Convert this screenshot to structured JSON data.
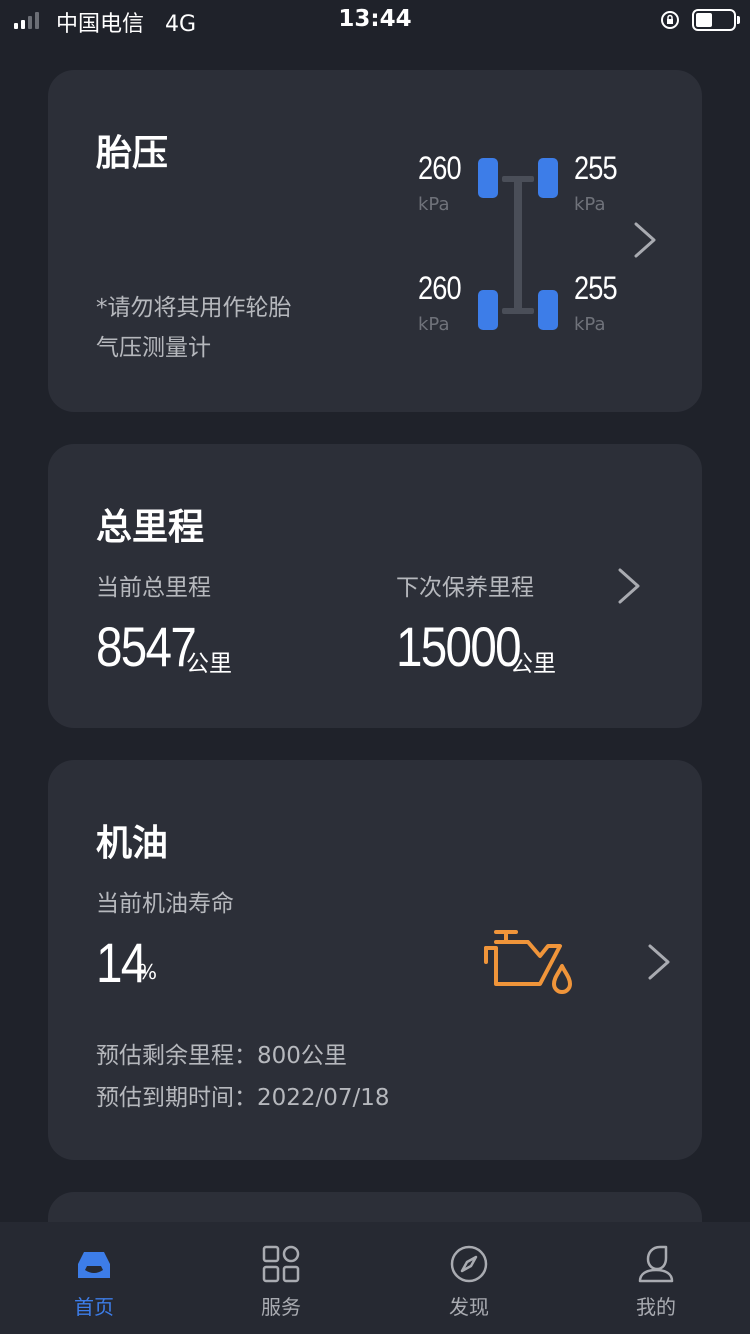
{
  "status_bar": {
    "carrier": "中国电信",
    "network": "4G",
    "time": "13:44"
  },
  "tire_pressure": {
    "title": "胎压",
    "note_line1": "*请勿将其用作轮胎",
    "note_line2": "气压测量计",
    "front_left": "260",
    "front_right": "255",
    "rear_left": "260",
    "rear_right": "255",
    "unit": "kPa",
    "tire_color": "#3d7de8"
  },
  "mileage": {
    "title": "总里程",
    "current_label": "当前总里程",
    "current_value": "8547",
    "next_label": "下次保养里程",
    "next_value": "15000",
    "unit": "公里"
  },
  "oil": {
    "title": "机油",
    "life_label": "当前机油寿命",
    "life_value": "14",
    "life_unit": "%",
    "remaining": "预估剩余里程：800公里",
    "due_date": "预估到期时间：2022/07/18",
    "icon": "oil-can-icon",
    "icon_color": "#f0953a"
  },
  "tabs": [
    {
      "label": "首页",
      "icon": "car-icon",
      "active": true
    },
    {
      "label": "服务",
      "icon": "grid-icon",
      "active": false
    },
    {
      "label": "发现",
      "icon": "compass-icon",
      "active": false
    },
    {
      "label": "我的",
      "icon": "person-icon",
      "active": false
    }
  ],
  "colors": {
    "background": "#1f222a",
    "card": "#2c2f38",
    "accent": "#3d7de8"
  }
}
